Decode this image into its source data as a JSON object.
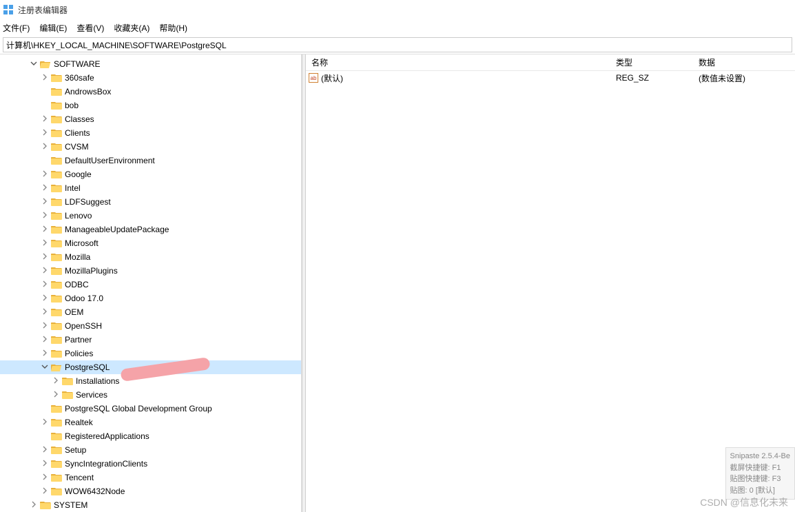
{
  "app": {
    "title": "注册表编辑器"
  },
  "menu": {
    "file": "文件(F)",
    "edit": "编辑(E)",
    "view": "查看(V)",
    "favorites": "收藏夹(A)",
    "help": "帮助(H)"
  },
  "path": "计算机\\HKEY_LOCAL_MACHINE\\SOFTWARE\\PostgreSQL",
  "list": {
    "headers": {
      "name": "名称",
      "type": "类型",
      "data": "数据"
    },
    "rows": [
      {
        "name": "(默认)",
        "type": "REG_SZ",
        "data": "(数值未设置)"
      }
    ]
  },
  "tree": [
    {
      "depth": 2,
      "exp": "open",
      "label": "SOFTWARE"
    },
    {
      "depth": 3,
      "exp": "closed",
      "label": "360safe"
    },
    {
      "depth": 3,
      "exp": "none",
      "label": "AndrowsBox"
    },
    {
      "depth": 3,
      "exp": "none",
      "label": "bob"
    },
    {
      "depth": 3,
      "exp": "closed",
      "label": "Classes"
    },
    {
      "depth": 3,
      "exp": "closed",
      "label": "Clients"
    },
    {
      "depth": 3,
      "exp": "closed",
      "label": "CVSM"
    },
    {
      "depth": 3,
      "exp": "none",
      "label": "DefaultUserEnvironment"
    },
    {
      "depth": 3,
      "exp": "closed",
      "label": "Google"
    },
    {
      "depth": 3,
      "exp": "closed",
      "label": "Intel"
    },
    {
      "depth": 3,
      "exp": "closed",
      "label": "LDFSuggest"
    },
    {
      "depth": 3,
      "exp": "closed",
      "label": "Lenovo"
    },
    {
      "depth": 3,
      "exp": "closed",
      "label": "ManageableUpdatePackage"
    },
    {
      "depth": 3,
      "exp": "closed",
      "label": "Microsoft"
    },
    {
      "depth": 3,
      "exp": "closed",
      "label": "Mozilla"
    },
    {
      "depth": 3,
      "exp": "closed",
      "label": "MozillaPlugins"
    },
    {
      "depth": 3,
      "exp": "closed",
      "label": "ODBC"
    },
    {
      "depth": 3,
      "exp": "closed",
      "label": "Odoo 17.0"
    },
    {
      "depth": 3,
      "exp": "closed",
      "label": "OEM"
    },
    {
      "depth": 3,
      "exp": "closed",
      "label": "OpenSSH"
    },
    {
      "depth": 3,
      "exp": "closed",
      "label": "Partner"
    },
    {
      "depth": 3,
      "exp": "closed",
      "label": "Policies"
    },
    {
      "depth": 3,
      "exp": "open",
      "label": "PostgreSQL",
      "selected": true
    },
    {
      "depth": 4,
      "exp": "closed",
      "label": "Installations"
    },
    {
      "depth": 4,
      "exp": "closed",
      "label": "Services"
    },
    {
      "depth": 3,
      "exp": "none",
      "label": "PostgreSQL Global Development Group"
    },
    {
      "depth": 3,
      "exp": "closed",
      "label": "Realtek"
    },
    {
      "depth": 3,
      "exp": "none",
      "label": "RegisteredApplications"
    },
    {
      "depth": 3,
      "exp": "closed",
      "label": "Setup"
    },
    {
      "depth": 3,
      "exp": "closed",
      "label": "SyncIntegrationClients"
    },
    {
      "depth": 3,
      "exp": "closed",
      "label": "Tencent"
    },
    {
      "depth": 3,
      "exp": "closed",
      "label": "WOW6432Node"
    },
    {
      "depth": 2,
      "exp": "closed",
      "label": "SYSTEM"
    }
  ],
  "snipaste": {
    "title": "Snipaste 2.5.4-Be",
    "line1": "截屏快捷键: F1",
    "line2": "贴图快捷键: F3",
    "line3": "贴图: 0 [默认]"
  },
  "watermark": "CSDN @信息化未来"
}
